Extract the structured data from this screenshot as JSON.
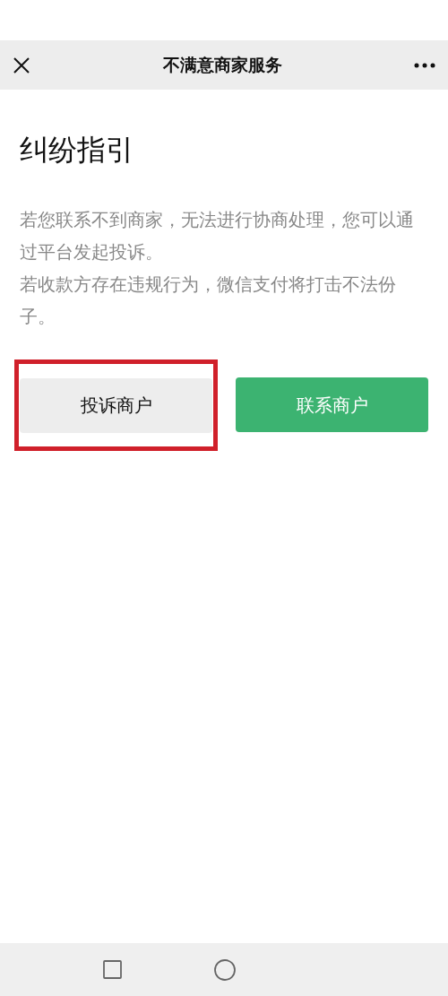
{
  "header": {
    "title": "不满意商家服务"
  },
  "heading": "纠纷指引",
  "paragraphs": [
    "若您联系不到商家，无法进行协商处理，您可以通过平台发起投诉。",
    "若收款方存在违规行为，微信支付将打击不法份子。"
  ],
  "buttons": [
    {
      "label": "投诉商户",
      "kind": "secondary",
      "highlighted": true
    },
    {
      "label": "联系商户",
      "kind": "primary",
      "highlighted": false
    }
  ]
}
